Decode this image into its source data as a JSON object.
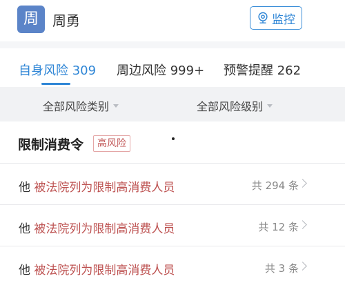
{
  "header": {
    "avatar_char": "周",
    "name": "周勇",
    "monitor_label": "监控"
  },
  "tabs": [
    {
      "label": "自身风险 309",
      "active": true
    },
    {
      "label": "周边风险 999+",
      "active": false
    },
    {
      "label": "预警提醒 262",
      "active": false
    }
  ],
  "filters": [
    {
      "label": "全部风险类别"
    },
    {
      "label": "全部风险级别"
    }
  ],
  "section": {
    "title": "限制消费令",
    "badge": "高风险"
  },
  "rows": [
    {
      "who": "他",
      "desc": "被法院列为限制高消费人员",
      "count_prefix": "共",
      "count": "294",
      "count_suffix": "条"
    },
    {
      "who": "他",
      "desc": "被法院列为限制高消费人员",
      "count_prefix": "共",
      "count": "12",
      "count_suffix": "条"
    },
    {
      "who": "他",
      "desc": "被法院列为限制高消费人员",
      "count_prefix": "共",
      "count": "3",
      "count_suffix": "条"
    }
  ],
  "colors": {
    "accent": "#2f86d6",
    "risk_text": "#bd5150",
    "avatar_bg": "#5b84c8"
  },
  "icons": {
    "monitor": "webcam-icon",
    "caret": "caret-down-icon",
    "chevron": "chevron-right-icon"
  }
}
